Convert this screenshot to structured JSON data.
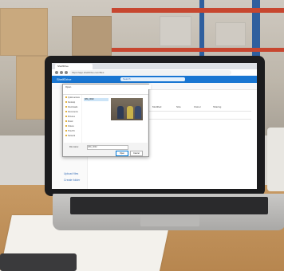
{
  "browser": {
    "tab_label": "ShelfDrive",
    "url": "https://app.shelfdrive.com/files"
  },
  "app": {
    "name": "ShelfDrive",
    "search_placeholder": "Search"
  },
  "dialog": {
    "title": "Open",
    "tree_items": [
      "Quick access",
      "Desktop",
      "Downloads",
      "Documents",
      "Pictures",
      "Music",
      "Videos",
      "This PC",
      "Network"
    ],
    "selected_file": "IMG_0042",
    "filename_label": "File name:",
    "open_label": "Open",
    "cancel_label": "Cancel"
  },
  "sidebar": {
    "links": [
      "Upload files",
      "Create folder"
    ]
  },
  "grid": {
    "headers": [
      "Name",
      "Modified",
      "Size",
      "Owner",
      "Sharing"
    ]
  },
  "colors": {
    "app_accent": "#1976d2",
    "rack_blue": "#2f5f9e",
    "rack_red": "#c7462f"
  }
}
